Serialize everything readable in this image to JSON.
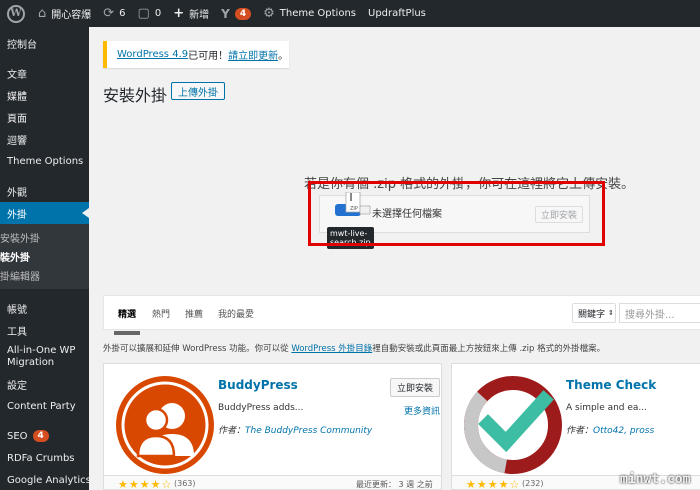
{
  "adminbar": {
    "site_name": "開心容爆",
    "updates_count": "6",
    "comments_count": "0",
    "new_label": "新增",
    "yoast_badge": "4",
    "theme_options": "Theme Options",
    "updraft": "UpdraftPlus"
  },
  "sidebar": {
    "items": [
      {
        "label": "控制台"
      },
      {
        "label": "文章"
      },
      {
        "label": "媒體"
      },
      {
        "label": "頁面"
      },
      {
        "label": "迴響"
      },
      {
        "label": "Theme Options"
      },
      {
        "label": "外觀"
      },
      {
        "label": "外掛"
      },
      {
        "label": "帳號"
      },
      {
        "label": "工具"
      },
      {
        "label": "All-in-One WP Migration"
      },
      {
        "label": "設定"
      },
      {
        "label": "Content Party"
      },
      {
        "label": "SEO",
        "badge": "4"
      },
      {
        "label": "RDFa Crumbs"
      },
      {
        "label": "Google Analytics"
      }
    ],
    "submenu": [
      "安裝外掛",
      "裝外掛",
      "掛編輯器"
    ]
  },
  "notice": {
    "version_link": "WordPress 4.9",
    "middle": " 已可用！",
    "update_link": "請立即更新",
    "dot": "。"
  },
  "page": {
    "title": "安裝外掛",
    "upload_button": "上傳外掛"
  },
  "upload": {
    "description": "若是你有個 .zip 格式的外掛，你可在這裡將它上傳安裝。",
    "no_file": "未選擇任何檔案",
    "install_button": "立即安裝",
    "drag_filename_1": "mwt-live-",
    "drag_filename_2": "search.zip",
    "file_icon_text": "ZIP"
  },
  "filter": {
    "tabs": [
      "精選",
      "熱門",
      "推薦",
      "我的最愛"
    ],
    "keyword_select": "關鍵字",
    "search_placeholder": "搜尋外掛..."
  },
  "intro": {
    "before": "外掛可以擴展和延伸 WordPress 功能。你可以從 ",
    "link": "WordPress 外掛目錄",
    "after": "裡自動安裝或此頁面最上方按鈕來上傳 .zip 格式的外掛檔案。"
  },
  "cards": [
    {
      "name": "BuddyPress",
      "desc": "BuddyPress adds...",
      "author_prefix": "作者：",
      "author": "The BuddyPress Community",
      "install": "立即安裝",
      "more": "更多資訊",
      "ratings": "(363)",
      "updated": "最近更新：  3 週 之前",
      "stars": "★★★★☆"
    },
    {
      "name": "Theme Check",
      "desc": "A simple and ea...",
      "author_prefix": "作者：",
      "author": "Otto42, pross",
      "ratings": "(232)",
      "stars": "★★★★☆"
    }
  ],
  "watermark": "minwt.com",
  "colors": {
    "adminbar": "#23282d",
    "sidebar_current": "#0073aa",
    "highlight_box": "#e00000",
    "buddypress": "#d84800",
    "theme_check_teal": "#3dbea4"
  }
}
